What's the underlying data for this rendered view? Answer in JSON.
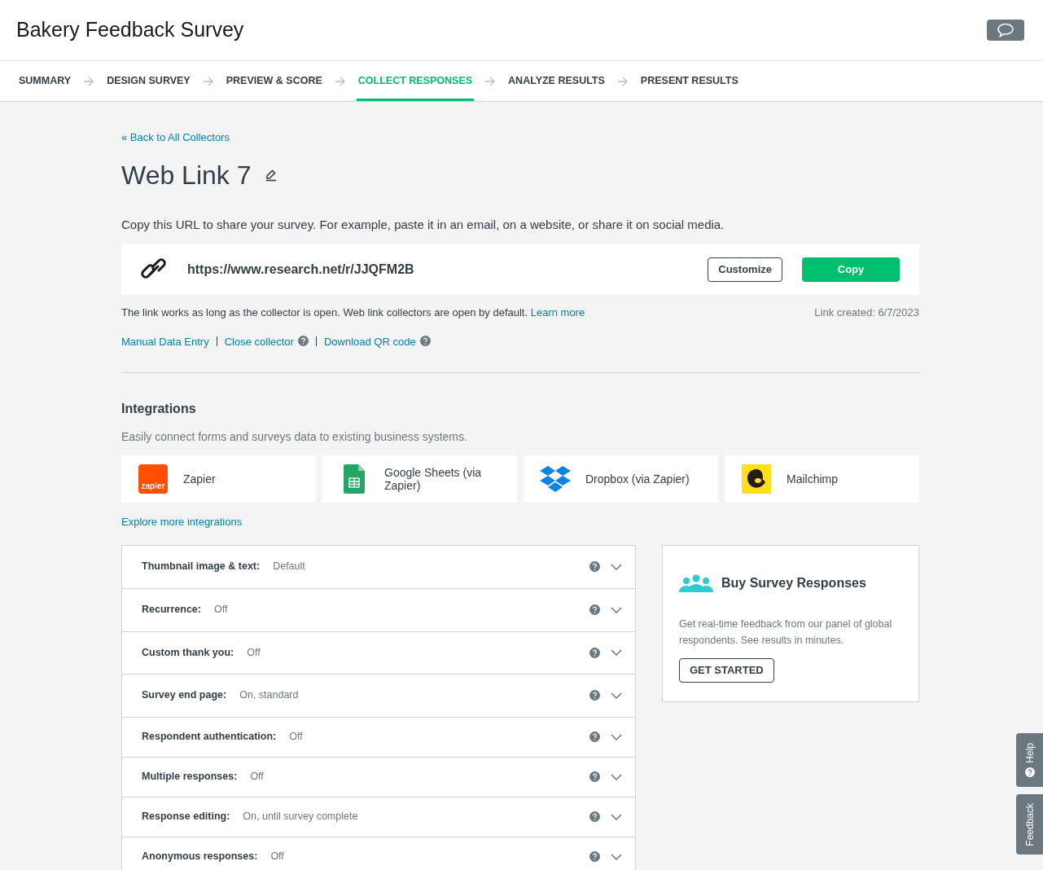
{
  "header": {
    "title": "Bakery Feedback Survey"
  },
  "steps": [
    {
      "label": "SUMMARY",
      "selected": false
    },
    {
      "label": "DESIGN SURVEY",
      "selected": false
    },
    {
      "label": "PREVIEW & SCORE",
      "selected": false
    },
    {
      "label": "COLLECT RESPONSES",
      "selected": true
    },
    {
      "label": "ANALYZE RESULTS",
      "selected": false
    },
    {
      "label": "PRESENT RESULTS",
      "selected": false
    }
  ],
  "back_link": "« Back to All Collectors",
  "collector_name": "Web Link 7",
  "instructions": "Copy this URL to share your survey. For example, paste it in an email, on a website, or share it on social media.",
  "url": "https://www.research.net/r/JJQFM2B",
  "buttons": {
    "customize": "Customize",
    "copy": "Copy"
  },
  "note": "The link works as long as the collector is open. Web link collectors are open by default.",
  "learn_more": "Learn more",
  "link_created": "Link created: 6/7/2023",
  "actions": [
    {
      "label": "Manual Data Entry",
      "help": false
    },
    {
      "label": "Close collector",
      "help": true
    },
    {
      "label": "Download QR code",
      "help": true
    }
  ],
  "integrations": {
    "title": "Integrations",
    "subtitle": "Easily connect forms and surveys data to existing business systems.",
    "items": [
      {
        "kind": "zapier",
        "name": "Zapier",
        "logo_text": "zapier"
      },
      {
        "kind": "sheets",
        "name": "Google Sheets (via Zapier)"
      },
      {
        "kind": "dropbox",
        "name": "Dropbox (via Zapier)"
      },
      {
        "kind": "mailchimp",
        "name": "Mailchimp"
      }
    ],
    "more": "Explore more integrations"
  },
  "settings": [
    {
      "label": "Thumbnail image & text:",
      "value": "Default"
    },
    {
      "label": "Recurrence:",
      "value": "Off"
    },
    {
      "label": "Custom thank you:",
      "value": "Off"
    },
    {
      "label": "Survey end page:",
      "value": "On, standard"
    },
    {
      "label": "Respondent authentication:",
      "value": "Off"
    },
    {
      "label": "Multiple responses:",
      "value": "Off"
    },
    {
      "label": "Response editing:",
      "value": "On, until survey complete"
    },
    {
      "label": "Anonymous responses:",
      "value": "Off"
    }
  ],
  "promo": {
    "title": "Buy Survey Responses",
    "text": "Get real-time feedback from our panel of global respondents. See results in minutes.",
    "button": "GET STARTED"
  },
  "side_tabs": [
    {
      "kind": "help",
      "label": "Help"
    },
    {
      "kind": "feedback",
      "label": "Feedback"
    }
  ]
}
